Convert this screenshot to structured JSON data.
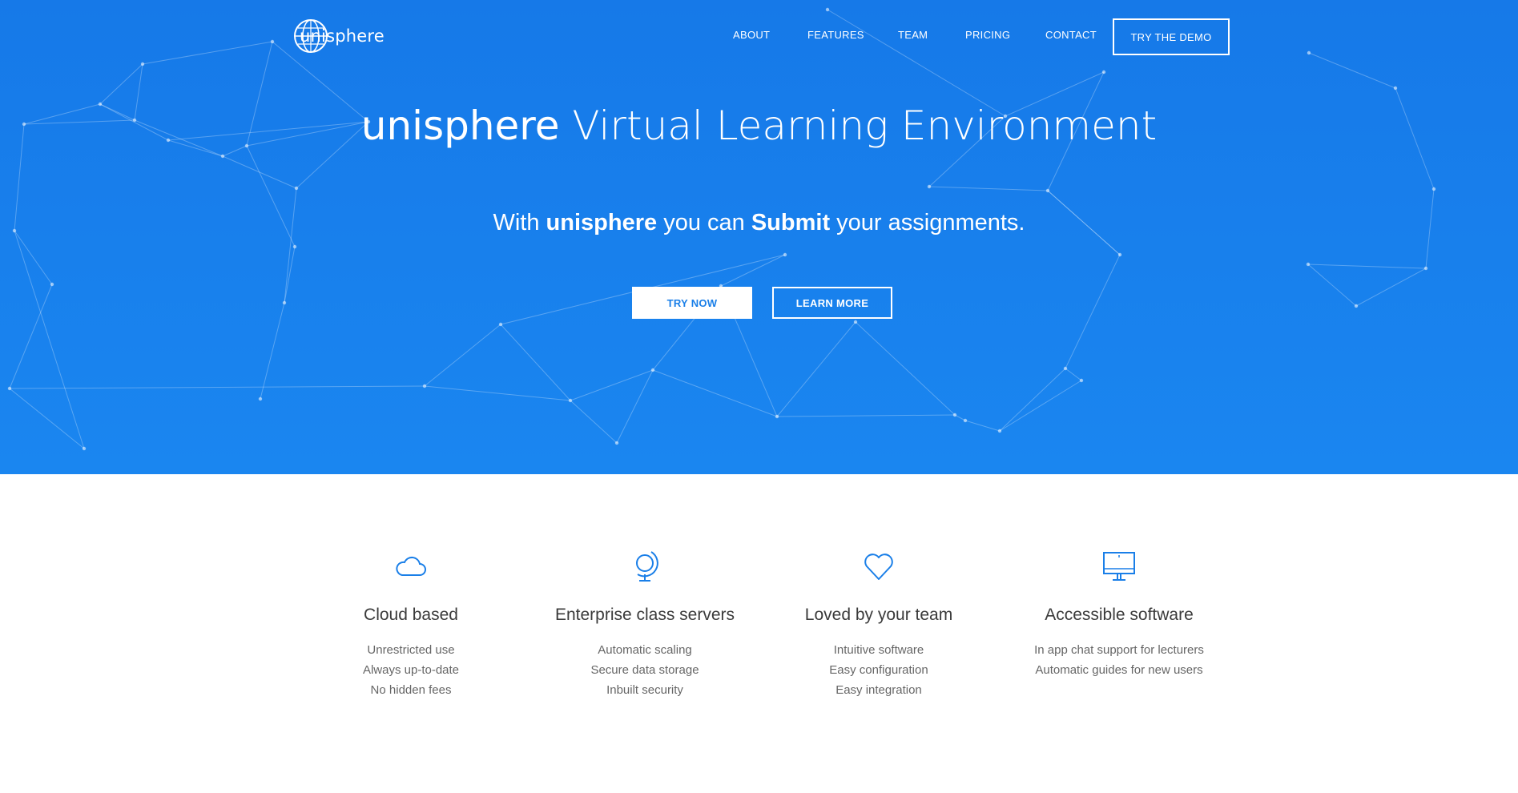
{
  "brand": {
    "logo_prefix": "uni",
    "logo_suffix": "sphere",
    "accent_color": "#1a7fe8"
  },
  "nav": {
    "items": [
      {
        "label": "ABOUT"
      },
      {
        "label": "FEATURES"
      },
      {
        "label": "TEAM"
      },
      {
        "label": "PRICING"
      },
      {
        "label": "CONTACT"
      }
    ],
    "cta_label": "TRY THE DEMO"
  },
  "hero": {
    "headline_bold": "unisphere",
    "headline_rest": " Virtual Learning Environment",
    "sub_1": "With ",
    "sub_2": "unisphere",
    "sub_3": " you can ",
    "sub_4": "Submit",
    "sub_5": " your assignments.",
    "primary_button": "TRY NOW",
    "secondary_button": "LEARN MORE"
  },
  "features": [
    {
      "icon": "cloud-icon",
      "title": "Cloud based",
      "items": [
        "Unrestricted use",
        "Always up-to-date",
        "No hidden fees"
      ]
    },
    {
      "icon": "globe-icon",
      "title": "Enterprise class servers",
      "items": [
        "Automatic scaling",
        "Secure data storage",
        "Inbuilt security"
      ]
    },
    {
      "icon": "heart-icon",
      "title": "Loved by your team",
      "items": [
        "Intuitive software",
        "Easy configuration",
        "Easy integration"
      ]
    },
    {
      "icon": "monitor-icon",
      "title": "Accessible software",
      "items": [
        "In app chat support for lecturers",
        "Automatic guides for new users"
      ]
    }
  ]
}
